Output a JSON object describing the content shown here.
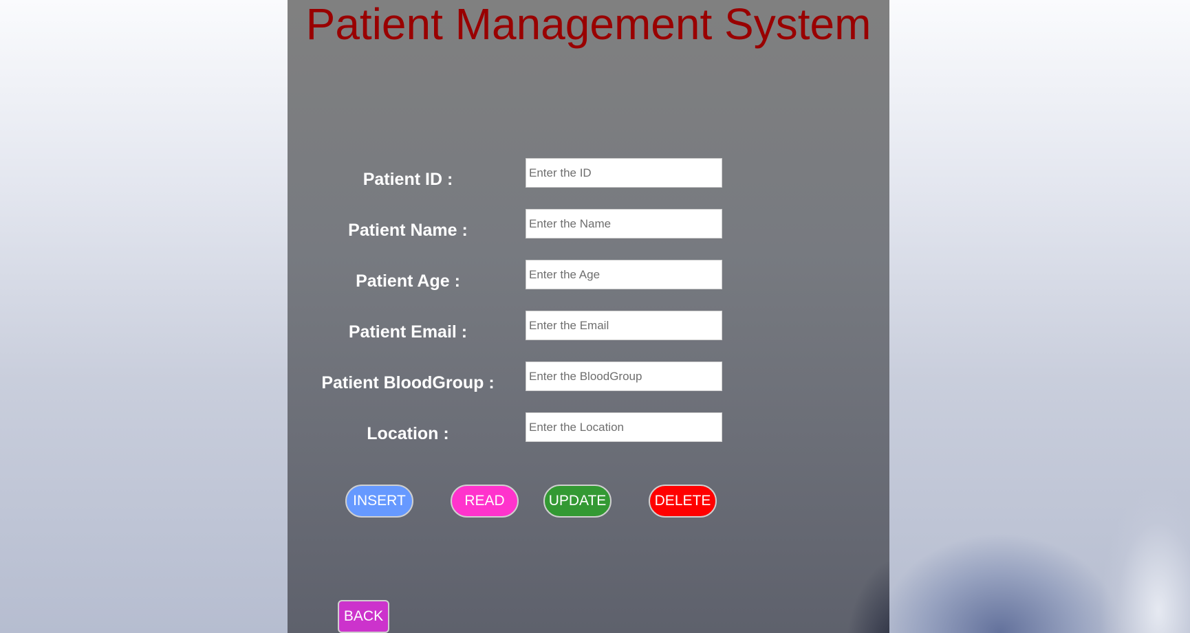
{
  "page": {
    "title": "Patient Management System"
  },
  "form": {
    "fields": [
      {
        "label": "Patient ID :",
        "placeholder": "Enter the ID",
        "value": ""
      },
      {
        "label": "Patient Name :",
        "placeholder": "Enter the Name",
        "value": ""
      },
      {
        "label": "Patient Age :",
        "placeholder": "Enter the Age",
        "value": ""
      },
      {
        "label": "Patient Email :",
        "placeholder": "Enter the Email",
        "value": ""
      },
      {
        "label": "Patient BloodGroup :",
        "placeholder": "Enter the BloodGroup",
        "value": ""
      },
      {
        "label": "Location :",
        "placeholder": "Enter the Location",
        "value": ""
      }
    ]
  },
  "actions": {
    "insert_label": "INSERT",
    "read_label": "READ",
    "update_label": "UPDATE",
    "delete_label": "DELETE",
    "back_label": "BACK"
  },
  "colors": {
    "title": "#990000",
    "insert": "#6699ff",
    "read": "#ff33cc",
    "update": "#339933",
    "delete": "#ff0000",
    "back": "#cc33cc"
  }
}
